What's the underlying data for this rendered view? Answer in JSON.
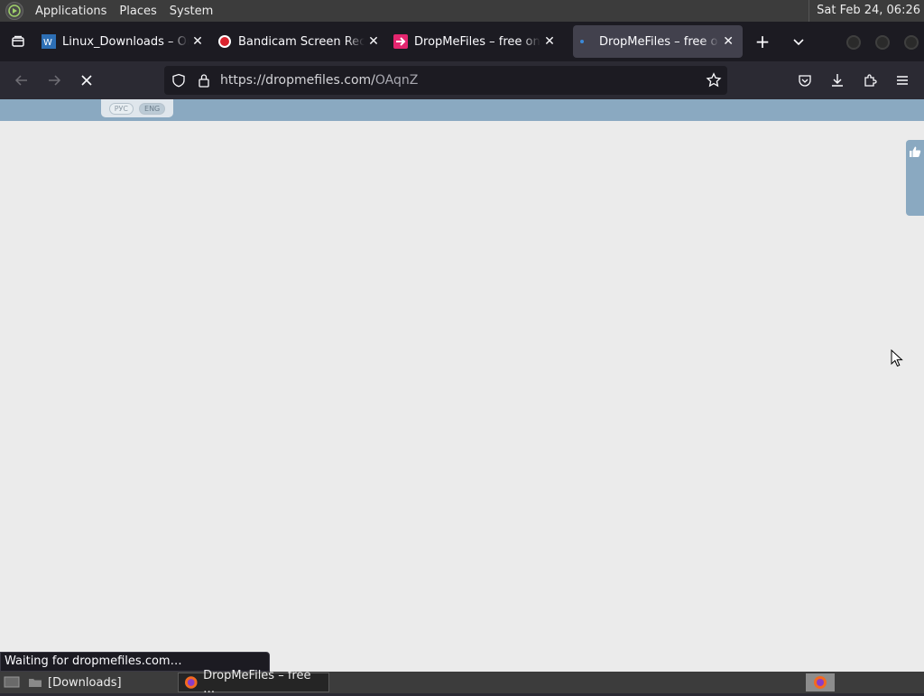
{
  "system_panel": {
    "menus": [
      "Applications",
      "Places",
      "System"
    ],
    "clock": "Sat Feb 24, 06:26"
  },
  "browser": {
    "tabs": [
      {
        "title": "Linux_Downloads – On",
        "favicon": "linux-downloads-icon",
        "active": false
      },
      {
        "title": "Bandicam Screen Reco",
        "favicon": "bandicam-record-icon",
        "active": false
      },
      {
        "title": "DropMeFiles – free one",
        "favicon": "dropmefiles-arrow-icon",
        "active": false
      },
      {
        "title": "DropMeFiles – free one",
        "favicon": "loading-dot-icon",
        "active": true
      }
    ],
    "new_tab_label": "+",
    "url": {
      "host": "https://dropmefiles.com/",
      "path": "OAqnZ"
    },
    "status_text": "Waiting for dropmefiles.com…"
  },
  "page": {
    "lang_options": [
      "РУС",
      "ENG"
    ],
    "selected_lang": "ENG"
  },
  "taskbar": {
    "items": [
      {
        "label": "[Downloads]",
        "icon": "folder-icon"
      },
      {
        "label": "DropMeFiles – free …",
        "icon": "firefox-icon"
      }
    ]
  },
  "colors": {
    "header_blue": "#8aa9c1",
    "page_bg": "#ebebeb",
    "browser_chrome": "#2b2a33",
    "tab_strip": "#1c1b22"
  }
}
